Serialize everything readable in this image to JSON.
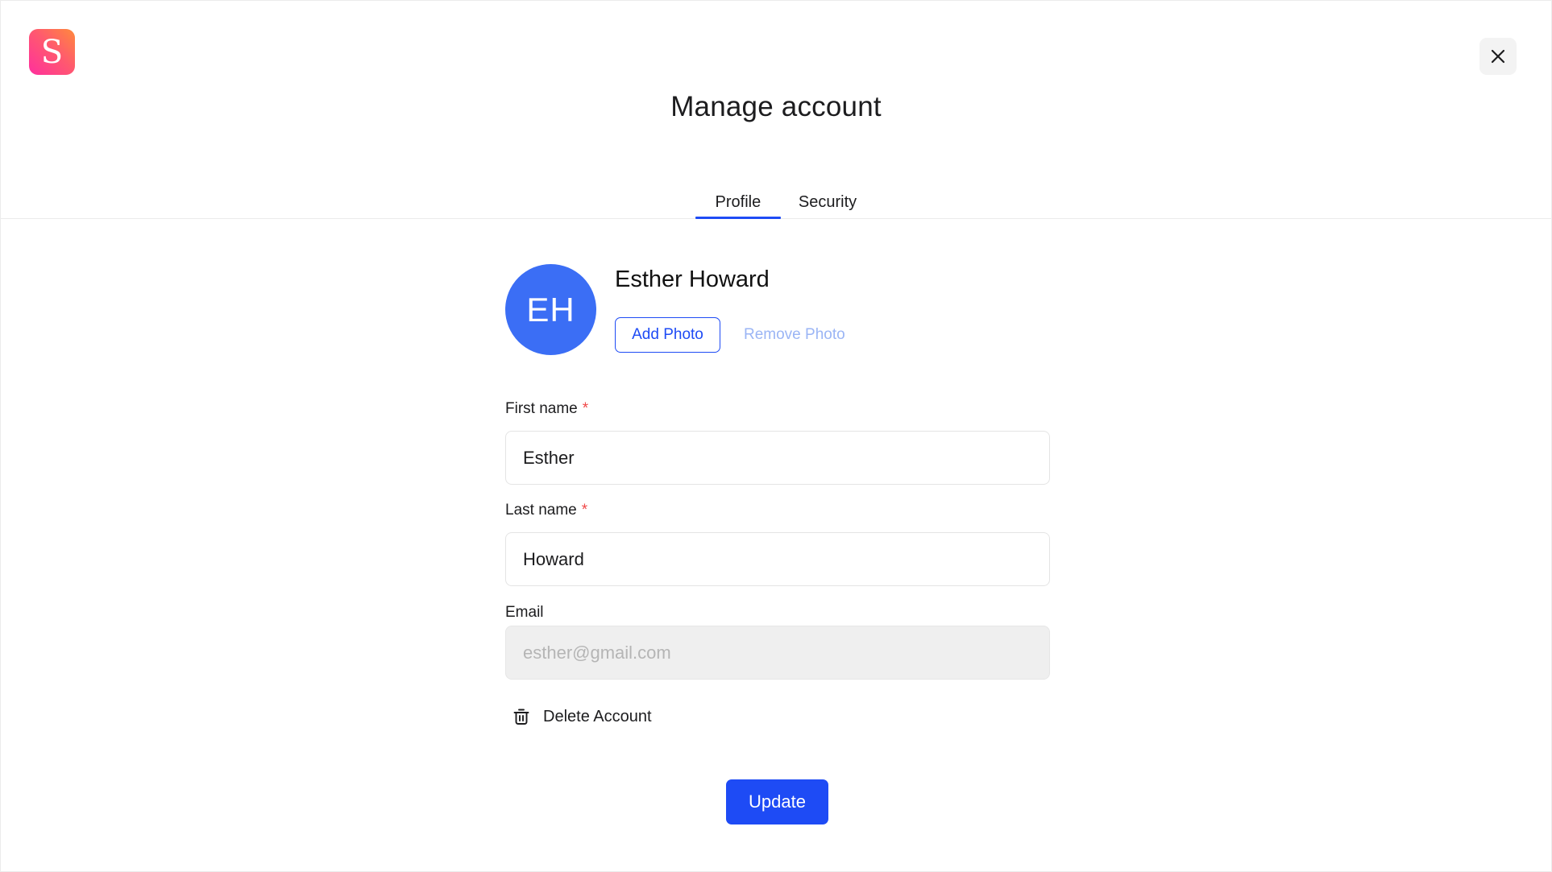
{
  "app": {
    "logo_letter": "S",
    "logo_icon": "brand-logo-icon",
    "close_icon": "close-icon"
  },
  "header": {
    "title": "Manage account"
  },
  "tabs": [
    {
      "label": "Profile",
      "active": true
    },
    {
      "label": "Security",
      "active": false
    }
  ],
  "profile": {
    "avatar_initials": "EH",
    "avatar_color": "#3b6ef5",
    "full_name": "Esther Howard",
    "add_photo_label": "Add Photo",
    "remove_photo_label": "Remove Photo"
  },
  "form": {
    "first_name": {
      "label": "First name",
      "required_mark": "*",
      "value": "Esther"
    },
    "last_name": {
      "label": "Last name",
      "required_mark": "*",
      "value": "Howard"
    },
    "email": {
      "label": "Email",
      "placeholder": "esther@gmail.com",
      "disabled": true
    }
  },
  "actions": {
    "delete_account_label": "Delete Account",
    "delete_icon": "trash-icon",
    "update_label": "Update"
  },
  "colors": {
    "accent": "#1e4bf5",
    "required": "#f04848",
    "remove_photo": "#9bb5f5"
  }
}
